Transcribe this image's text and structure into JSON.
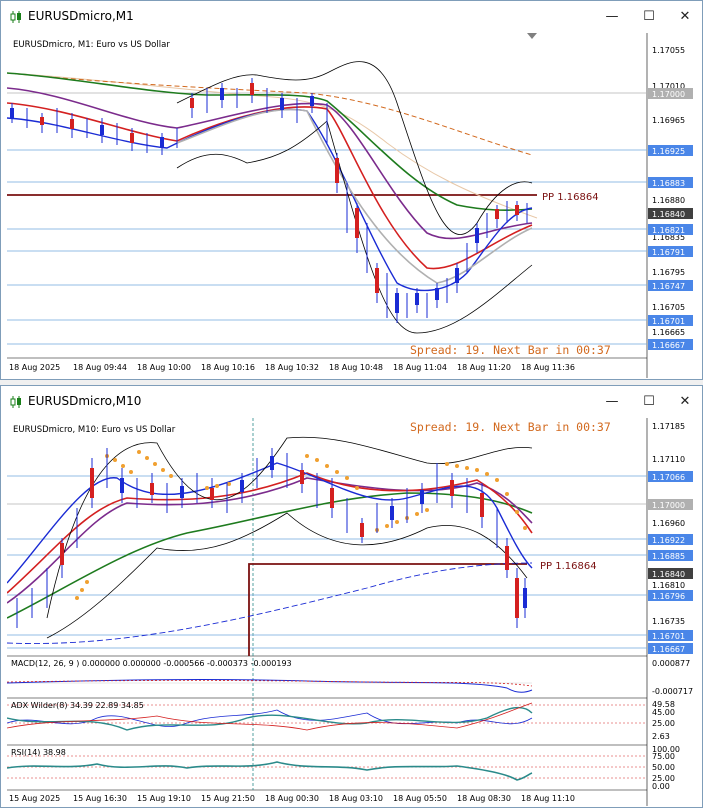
{
  "windows": [
    {
      "title": "EURUSDmicro,M1",
      "header": "EURUSDmicro, M1:  Euro vs US Dollar",
      "spread": "Spread: 19. Next Bar in 00:37",
      "pp_label": "PP 1.16864",
      "price_axis": [
        "1.17055",
        "1.17010",
        "1.16965",
        "1.16880",
        "1.16835",
        "1.16795",
        "1.16705",
        "1.16665"
      ],
      "price_boxes": [
        {
          "label": "1.17000",
          "color": "#b0b0b0"
        },
        {
          "label": "1.16925",
          "color": "#4a86e8"
        },
        {
          "label": "1.16883",
          "color": "#4a86e8"
        },
        {
          "label": "1.16840",
          "color": "#404040"
        },
        {
          "label": "1.16821",
          "color": "#4a86e8"
        },
        {
          "label": "1.16791",
          "color": "#4a86e8"
        },
        {
          "label": "1.16747",
          "color": "#4a86e8"
        },
        {
          "label": "1.16701",
          "color": "#4a86e8"
        },
        {
          "label": "1.16667",
          "color": "#4a86e8"
        }
      ],
      "time_axis": [
        "18 Aug 2025",
        "18 Aug 09:44",
        "18 Aug 10:00",
        "18 Aug 10:16",
        "18 Aug 10:32",
        "18 Aug 10:48",
        "18 Aug 11:04",
        "18 Aug 11:20",
        "18 Aug 11:36"
      ]
    },
    {
      "title": "EURUSDmicro,M10",
      "header": "EURUSDmicro, M10:  Euro vs US Dollar",
      "spread": "Spread: 19. Next Bar in 00:37",
      "pp_label": "PP 1.16864",
      "price_axis": [
        "1.17185",
        "1.17110",
        "1.16960",
        "1.16810",
        "1.16735"
      ],
      "price_boxes": [
        {
          "label": "1.17066",
          "color": "#4a86e8"
        },
        {
          "label": "1.17000",
          "color": "#b0b0b0"
        },
        {
          "label": "1.16922",
          "color": "#4a86e8"
        },
        {
          "label": "1.16885",
          "color": "#4a86e8"
        },
        {
          "label": "1.16840",
          "color": "#404040"
        },
        {
          "label": "1.16796",
          "color": "#4a86e8"
        },
        {
          "label": "1.16701",
          "color": "#4a86e8"
        },
        {
          "label": "1.16667",
          "color": "#4a86e8"
        }
      ],
      "macd_label": "MACD(12, 26, 9 ) 0.000000 0.000000 -0.000566 -0.000373 -0.000193",
      "macd_axis": [
        "0.000877",
        "-0.000717"
      ],
      "adx_label": "ADX Wilder(8) 34.39 22.89 34.85",
      "adx_axis": [
        "49.58",
        "45.00",
        "25.00",
        "2.63"
      ],
      "rsi_label": "RSI(14) 38.98",
      "rsi_axis": [
        "100.00",
        "75.00",
        "50.00",
        "25.00",
        "0.00"
      ],
      "time_axis": [
        "15 Aug 2025",
        "15 Aug 16:30",
        "15 Aug 19:10",
        "15 Aug 21:50",
        "18 Aug 00:30",
        "18 Aug 03:10",
        "18 Aug 05:50",
        "18 Aug 08:30",
        "18 Aug 11:10"
      ]
    }
  ],
  "window_controls": {
    "minimize": "—",
    "maximize": "☐",
    "close": "✕"
  }
}
